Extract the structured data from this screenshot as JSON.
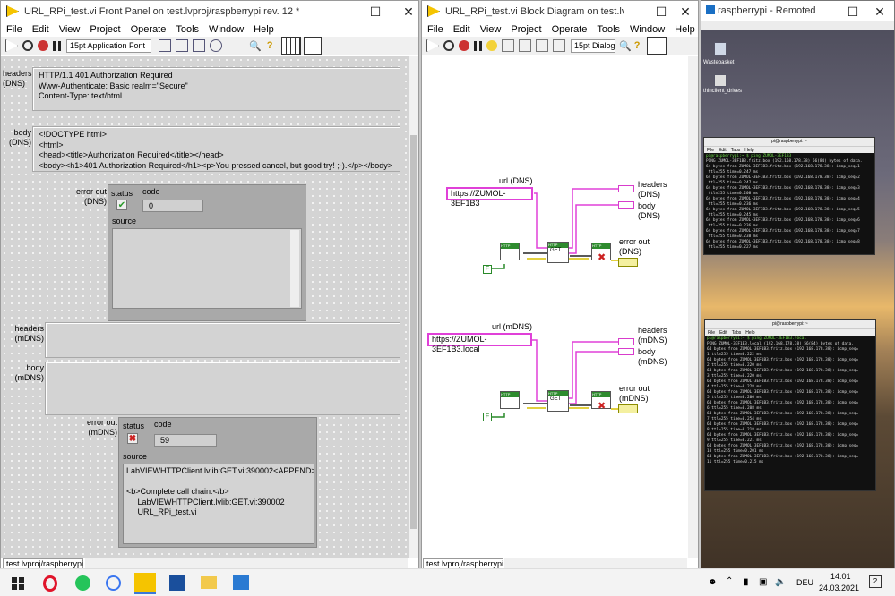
{
  "front_panel": {
    "title": "URL_RPi_test.vi Front Panel on test.lvproj/raspberrypi rev. 12 *",
    "menu": [
      "File",
      "Edit",
      "View",
      "Project",
      "Operate",
      "Tools",
      "Window",
      "Help"
    ],
    "font_select": "15pt Application Font",
    "headers_dns_label": "headers\n(DNS)",
    "headers_dns_value": "HTTP/1.1 401 Authorization Required\nWww-Authenticate: Basic realm=\"Secure\"\nContent-Type: text/html",
    "body_dns_label": "body\n(DNS)",
    "body_dns_value": "<!DOCTYPE html>\n<html>\n<head><title>Authorization Required</title></head>\n<body><h1>401 Authorization Required</h1><p>You pressed cancel, but good try! ;-).</p></body>",
    "error_dns": {
      "label": "error out\n(DNS)",
      "status_label": "status",
      "code_label": "code",
      "code": "0",
      "source_label": "source"
    },
    "headers_mdns_label": "headers\n(mDNS)",
    "body_mdns_label": "body\n(mDNS)",
    "error_mdns": {
      "label": "error out\n(mDNS)",
      "status_label": "status",
      "code_label": "code",
      "code": "59",
      "source_label": "source",
      "source": "LabVIEWHTTPClient.lvlib:GET.vi:390002<APPEND>\n\n<b>Complete call chain:</b>\n     LabVIEWHTTPClient.lvlib:GET.vi:390002\n     URL_RPi_test.vi"
    },
    "status_bar": "test.lvproj/raspberrypi"
  },
  "block_diagram": {
    "title": "URL_RPi_test.vi Block Diagram on test.lvproj/ra...",
    "menu": [
      "File",
      "Edit",
      "View",
      "Project",
      "Operate",
      "Tools",
      "Window",
      "Help"
    ],
    "font_select": "15pt Dialog",
    "url_dns_label": "url (DNS)",
    "url_dns": "https://ZUMOL-3EF1B3",
    "headers_dns": "headers\n(DNS)",
    "body_dns": "body\n(DNS)",
    "error_dns": "error out\n(DNS)",
    "url_mdns_label": "url (mDNS)",
    "url_mdns": "https://ZUMOL-3EF1B3.local",
    "headers_mdns": "headers\n(mDNS)",
    "body_mdns": "body\n(mDNS)",
    "error_mdns": "error out\n(mDNS)",
    "node_http": "HTTP",
    "node_get": "GET",
    "bool_f": "F",
    "status_bar": "test.lvproj/raspberrypi"
  },
  "remote": {
    "title": "raspberrypi - Remoted...",
    "desktop_icons": [
      "Wastebasket",
      "thinclient_drives"
    ],
    "term1_title": "pi@raspberrypi: ~",
    "term2_title": "pi@raspberrypi: ~",
    "term_menu": [
      "File",
      "Edit",
      "Tabs",
      "Help"
    ],
    "term1_lines": [
      "pi@raspberrypi:~ $ ping ZUMOL-3EF1B3",
      "PING ZUMOL-3EF1B3.fritz.box (192.168.178.38) 56(84) bytes of data.",
      "64 bytes from ZUMOL-3EF1B3.fritz.box (192.168.178.38): icmp_seq=1",
      " ttl=255 time=0.247 ms",
      "64 bytes from ZUMOL-3EF1B3.fritz.box (192.168.178.38): icmp_seq=2",
      " ttl=255 time=0.247 ms",
      "64 bytes from ZUMOL-3EF1B3.fritz.box (192.168.178.38): icmp_seq=3",
      " ttl=255 time=0.208 ms",
      "64 bytes from ZUMOL-3EF1B3.fritz.box (192.168.178.38): icmp_seq=4",
      " ttl=255 time=0.236 ms",
      "64 bytes from ZUMOL-3EF1B3.fritz.box (192.168.178.38): icmp_seq=5",
      " ttl=255 time=0.245 ms",
      "64 bytes from ZUMOL-3EF1B3.fritz.box (192.168.178.38): icmp_seq=6",
      " ttl=255 time=0.236 ms",
      "64 bytes from ZUMOL-3EF1B3.fritz.box (192.168.178.38): icmp_seq=7",
      " ttl=255 time=0.238 ms",
      "64 bytes from ZUMOL-3EF1B3.fritz.box (192.168.178.38): icmp_seq=8",
      " ttl=255 time=0.227 ms"
    ],
    "term2_lines": [
      "pi@raspberrypi:~ $ ping ZUMOL-3EF1B3.local",
      "PING ZUMOL-3EF1B3.local (192.168.178.38) 56(84) bytes of data.",
      "64 bytes from ZUMOL-3EF1B3.fritz.box (192.168.178.38): icmp_seq=",
      "1 ttl=255 time=0.222 ms",
      "64 bytes from ZUMOL-3EF1B3.fritz.box (192.168.178.38): icmp_seq=",
      "2 ttl=255 time=0.220 ms",
      "64 bytes from ZUMOL-3EF1B3.fritz.box (192.168.178.38): icmp_seq=",
      "3 ttl=255 time=0.220 ms",
      "64 bytes from ZUMOL-3EF1B3.fritz.box (192.168.178.38): icmp_seq=",
      "4 ttl=255 time=0.228 ms",
      "64 bytes from ZUMOL-3EF1B3.fritz.box (192.168.178.38): icmp_seq=",
      "5 ttl=255 time=0.206 ms",
      "64 bytes from ZUMOL-3EF1B3.fritz.box (192.168.178.38): icmp_seq=",
      "6 ttl=255 time=0.208 ms",
      "64 bytes from ZUMOL-3EF1B3.fritz.box (192.168.178.38): icmp_seq=",
      "7 ttl=255 time=0.254 ms",
      "64 bytes from ZUMOL-3EF1B3.fritz.box (192.168.178.38): icmp_seq=",
      "8 ttl=255 time=0.218 ms",
      "64 bytes from ZUMOL-3EF1B3.fritz.box (192.168.178.38): icmp_seq=",
      "9 ttl=255 time=0.221 ms",
      "64 bytes from ZUMOL-3EF1B3.fritz.box (192.168.178.38): icmp_seq=",
      "10 ttl=255 time=0.201 ms",
      "64 bytes from ZUMOL-3EF1B3.fritz.box (192.168.178.38): icmp_seq=",
      "11 ttl=255 time=0.215 ms"
    ]
  },
  "taskbar": {
    "lang": "DEU",
    "time": "14:01",
    "date": "24.03.2021",
    "notif": "2"
  }
}
